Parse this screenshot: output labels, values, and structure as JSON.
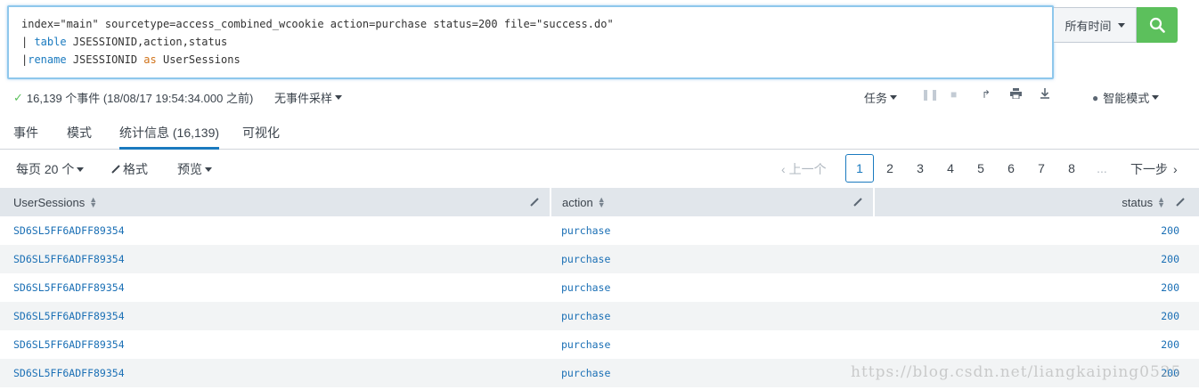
{
  "search": {
    "query_line1": "index=\"main\" sourcetype=access_combined_wcookie action=purchase status=200 file=\"success.do\"",
    "query_line2_pipe": "| ",
    "query_line2_cmd": "table",
    "query_line2_rest": " JSESSIONID,action,status",
    "query_line3_pipe": "|",
    "query_line3_cmd": "rename",
    "query_line3_mid": " JSESSIONID ",
    "query_line3_as": "as",
    "query_line3_rest": " UserSessions",
    "time_range": "所有时间",
    "search_icon": "search-icon"
  },
  "status": {
    "event_count": "16,139 个事件 (18/08/17 19:54:34.000 之前)",
    "sampling": "无事件采样",
    "job": "任务",
    "mode": "智能模式"
  },
  "tabs": [
    {
      "label": "事件"
    },
    {
      "label": "模式"
    },
    {
      "label": "统计信息 (16,139)"
    },
    {
      "label": "可视化"
    }
  ],
  "controls": {
    "per_page": "每页 20 个",
    "format": "格式",
    "preview": "预览",
    "prev": "上一个",
    "next": "下一步",
    "pages": [
      "1",
      "2",
      "3",
      "4",
      "5",
      "6",
      "7",
      "8",
      "..."
    ],
    "current_page": "1"
  },
  "table": {
    "columns": [
      "UserSessions",
      "action",
      "status"
    ],
    "rows": [
      [
        "SD6SL5FF6ADFF89354",
        "purchase",
        "200"
      ],
      [
        "SD6SL5FF6ADFF89354",
        "purchase",
        "200"
      ],
      [
        "SD6SL5FF6ADFF89354",
        "purchase",
        "200"
      ],
      [
        "SD6SL5FF6ADFF89354",
        "purchase",
        "200"
      ],
      [
        "SD6SL5FF6ADFF89354",
        "purchase",
        "200"
      ],
      [
        "SD6SL5FF6ADFF89354",
        "purchase",
        "200"
      ]
    ]
  },
  "colors": {
    "accent": "#1a7abf",
    "search_button": "#5cc05c",
    "header_bg": "#e1e6eb",
    "alt_row": "#f2f4f5"
  },
  "watermark": "https://blog.csdn.net/liangkaiping0525"
}
